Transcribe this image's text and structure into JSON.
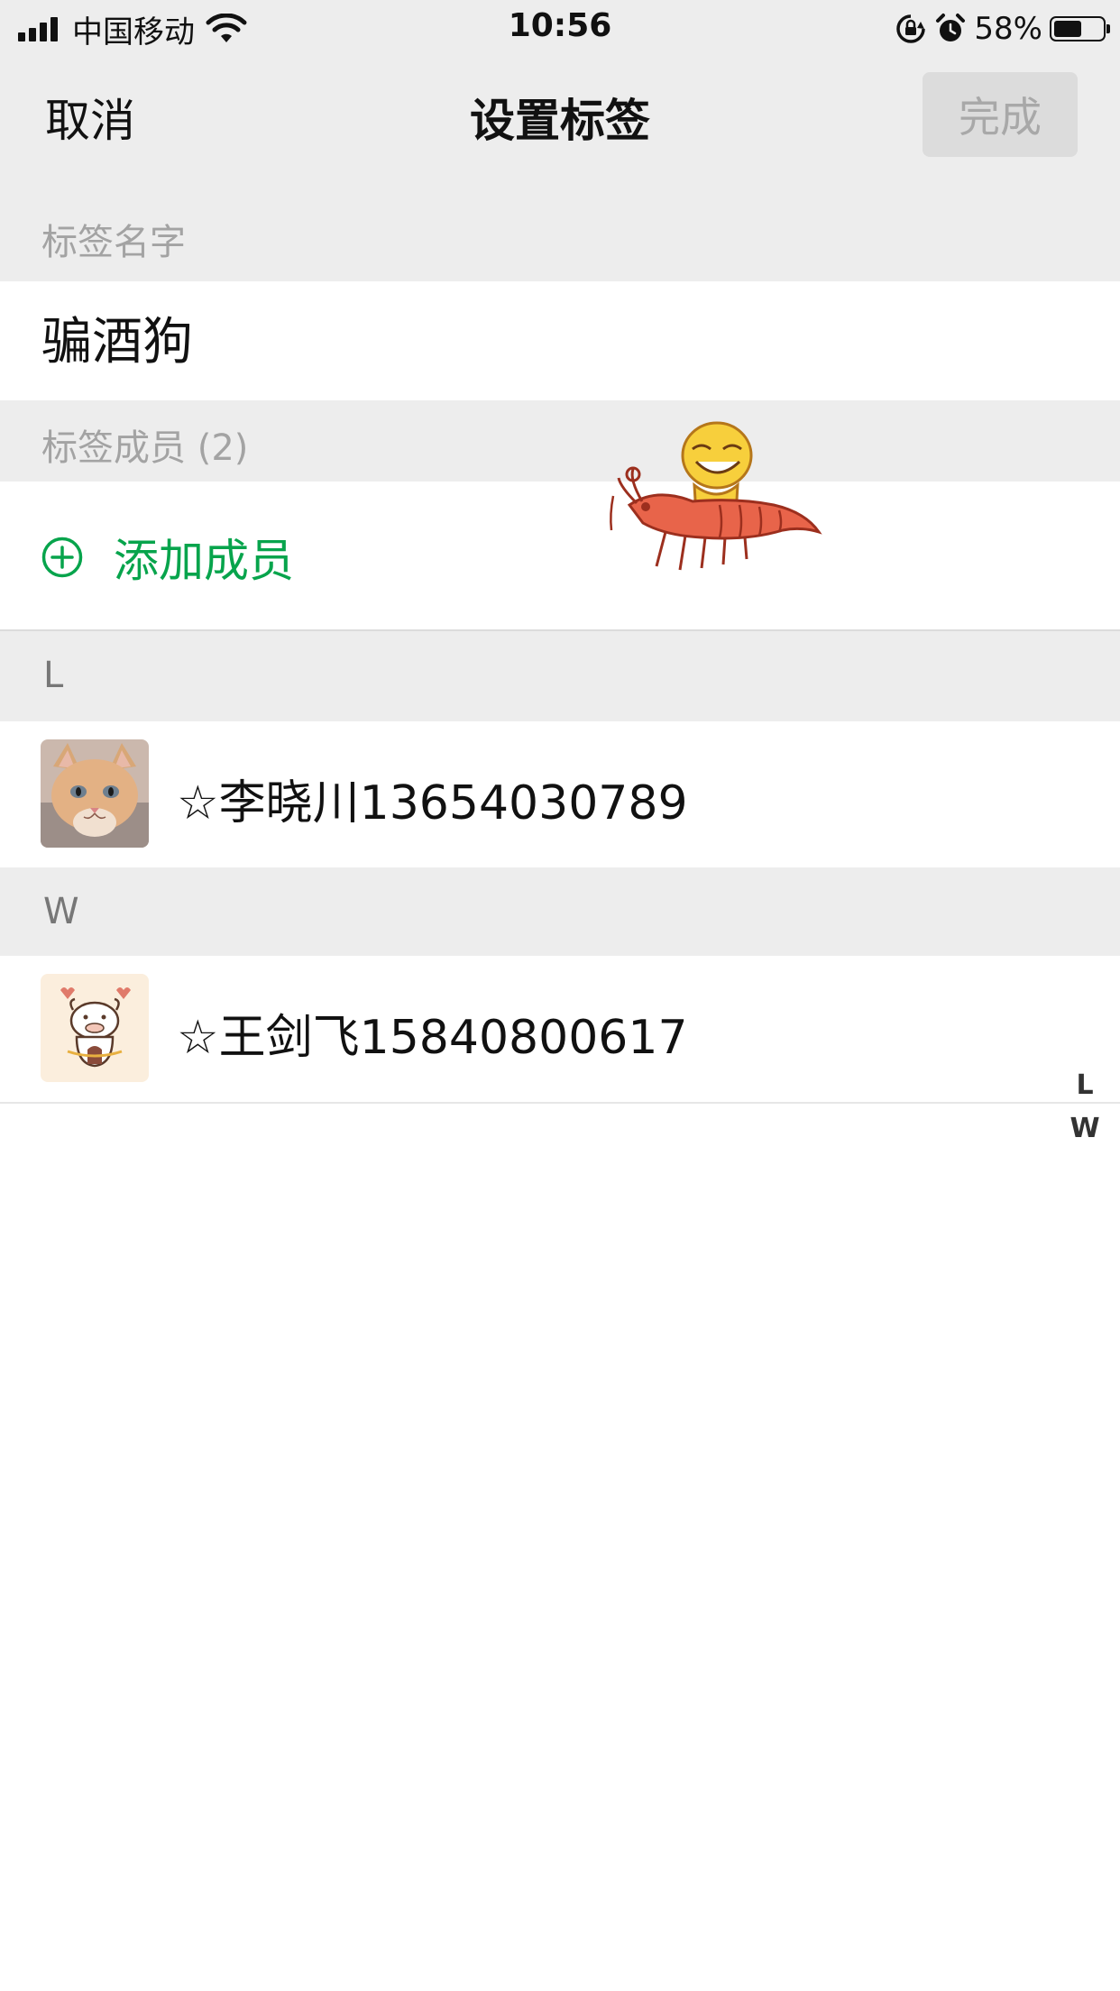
{
  "status_bar": {
    "carrier": "中国移动",
    "time": "10:56",
    "battery_percent_label": "58%",
    "battery_level": 0.58,
    "signal_bars": 4,
    "icons": [
      "signal-icon",
      "wifi-icon",
      "rotation-lock-icon",
      "alarm-icon",
      "battery-icon"
    ]
  },
  "nav": {
    "cancel_label": "取消",
    "title": "设置标签",
    "done_label": "完成"
  },
  "tag_name": {
    "header": "标签名字",
    "value": "骗酒狗"
  },
  "members": {
    "header": "标签成员 (2)",
    "add_label": "添加成员",
    "add_icon": "plus-circle-icon"
  },
  "groups": [
    {
      "letter": "L",
      "contacts": [
        {
          "name": "☆李晓川13654030789",
          "avatar": "cat-avatar"
        }
      ]
    },
    {
      "letter": "W",
      "contacts": [
        {
          "name": "☆王剑飞15840800617",
          "avatar": "cow-avatar"
        }
      ]
    }
  ],
  "index_bar": [
    "L",
    "W"
  ],
  "colors": {
    "accent_green": "#07a44c",
    "header_bg": "#ededed",
    "disabled_button_bg": "#dcdcdc",
    "disabled_button_text": "#a8a8a8"
  }
}
